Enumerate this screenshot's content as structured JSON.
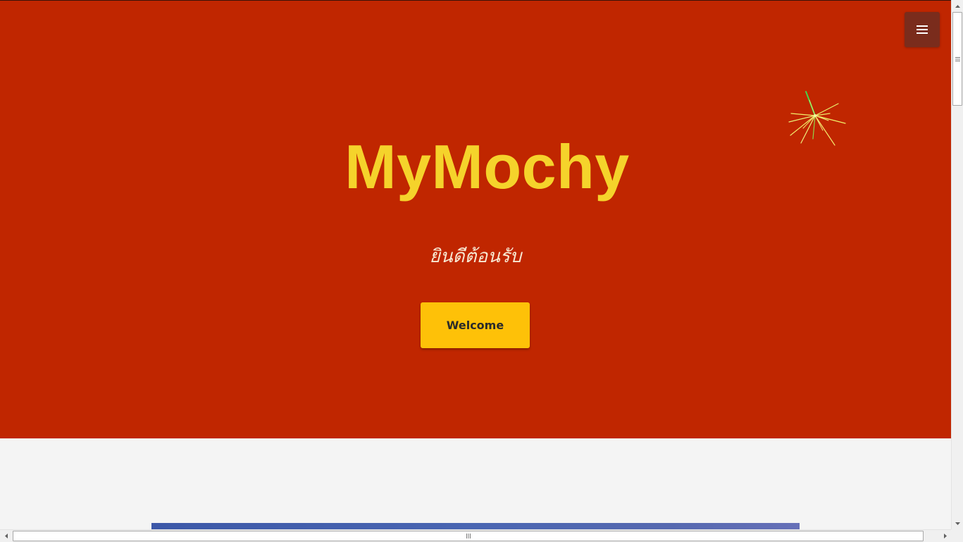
{
  "hero": {
    "title": "MyMochy",
    "subtitle": "ยินดีต้อนรับ",
    "cta_label": "Welcome",
    "background_color": "#c02600",
    "title_color": "#f5d32b",
    "cta_color": "#fec108"
  },
  "menu": {
    "icon": "hamburger-menu-icon",
    "button_color": "#7a2c1c"
  },
  "decor": {
    "firework_icon": "firework-icon"
  },
  "page": {
    "background_color": "#f4f4f4"
  }
}
